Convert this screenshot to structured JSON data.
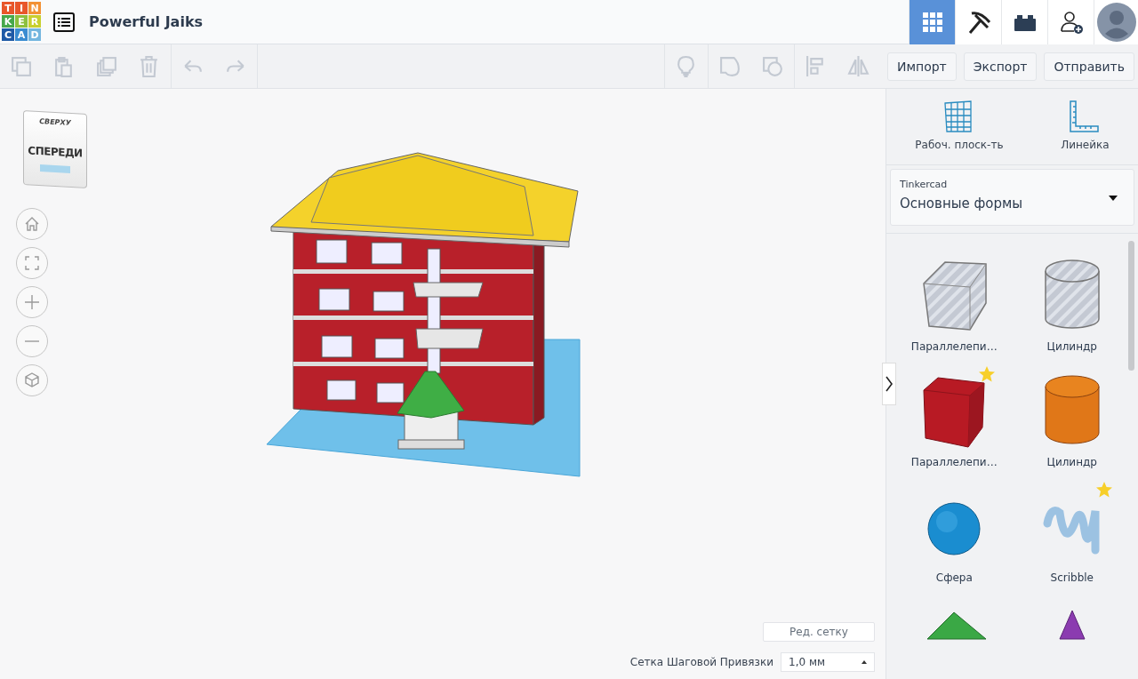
{
  "header": {
    "logo": [
      {
        "letter": "T",
        "color": "#e8562a"
      },
      {
        "letter": "I",
        "color": "#e8562a"
      },
      {
        "letter": "N",
        "color": "#f29134"
      },
      {
        "letter": "K",
        "color": "#47a84b"
      },
      {
        "letter": "E",
        "color": "#8dc03f"
      },
      {
        "letter": "R",
        "color": "#c8cf2e"
      },
      {
        "letter": "C",
        "color": "#1f5aa6"
      },
      {
        "letter": "A",
        "color": "#3a8cd1"
      },
      {
        "letter": "D",
        "color": "#74b6df"
      }
    ],
    "title": "Powerful Jaiks",
    "nav": [
      {
        "kind": "grid",
        "selected": true
      },
      {
        "kind": "pickaxe",
        "selected": false
      },
      {
        "kind": "brick",
        "selected": false
      },
      {
        "kind": "add-user",
        "selected": false
      }
    ]
  },
  "toolbar": {
    "tools": [
      {
        "kind": "copy",
        "disabled": true
      },
      {
        "kind": "paste",
        "disabled": true
      },
      {
        "kind": "duplicate",
        "disabled": true
      },
      {
        "kind": "delete",
        "disabled": true
      },
      {
        "kind": "undo",
        "disabled": true
      },
      {
        "kind": "redo",
        "disabled": true
      }
    ],
    "shape_tools": [
      {
        "kind": "bulb",
        "disabled": true
      },
      {
        "kind": "group",
        "disabled": true
      },
      {
        "kind": "ungroup",
        "disabled": true
      },
      {
        "kind": "align",
        "disabled": true
      },
      {
        "kind": "mirror",
        "disabled": true
      }
    ],
    "buttons": [
      "Импорт",
      "Экспорт",
      "Отправить"
    ]
  },
  "viewcube": {
    "top": "СВЕРХУ",
    "front": "СПЕРЕДИ"
  },
  "view_controls": [
    {
      "kind": "home"
    },
    {
      "kind": "fit"
    },
    {
      "kind": "zoom-in"
    },
    {
      "kind": "zoom-out"
    },
    {
      "kind": "perspective"
    }
  ],
  "grid_settings": {
    "edit_button": "Ред. сетку",
    "snap_label": "Сетка Шаговой Привязки",
    "snap_value": "1,0 мм"
  },
  "panel": {
    "tools": [
      {
        "kind": "workplane",
        "label": "Рабоч. плоск-ть"
      },
      {
        "kind": "ruler",
        "label": "Линейка"
      }
    ],
    "library": {
      "label": "Tinkercad",
      "value": "Основные формы"
    },
    "shapes": [
      {
        "kind": "box-hole",
        "name": "Параллелепи…",
        "starred": false
      },
      {
        "kind": "cylinder-hole",
        "name": "Цилиндр",
        "starred": false
      },
      {
        "kind": "box",
        "name": "Параллелепи…",
        "starred": true
      },
      {
        "kind": "cylinder",
        "name": "Цилиндр",
        "starred": false
      },
      {
        "kind": "sphere",
        "name": "Сфера",
        "starred": false
      },
      {
        "kind": "scribble",
        "name": "Scribble",
        "starred": true
      },
      {
        "kind": "roof",
        "starred": false
      },
      {
        "kind": "cone",
        "starred": false
      }
    ]
  }
}
